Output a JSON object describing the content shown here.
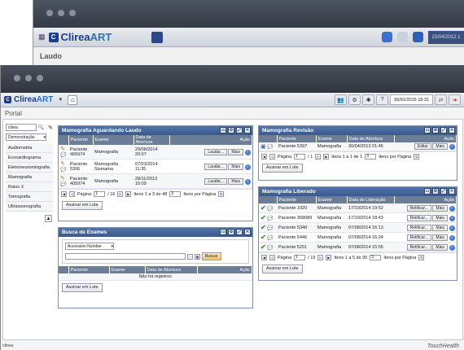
{
  "back_window": {
    "logo": "Clirea",
    "logo_suffix": "ART",
    "date": "23/04/2012 1",
    "page_title": "Laudo"
  },
  "toolbar": {
    "logo": "Clirea",
    "logo_suffix": "ART",
    "datetime": "30/01/2015 18:31"
  },
  "portal_title": "Portal",
  "leftnav": {
    "search_value": "clirea",
    "select_value": "Demonstração",
    "items": [
      "Audiometria",
      "Ecocardiograma",
      "Eletroneuromiografia",
      "Mamografia",
      "Raios X",
      "Tomografia",
      "Ultrassonografia"
    ]
  },
  "panel_aguardando": {
    "title": "Mamografia Aguardando Laudo",
    "headers": [
      "Paciente",
      "Exame",
      "Data de Abertura",
      "Ação"
    ],
    "rows": [
      {
        "paciente": "Paciente 405974",
        "exame": "Mamografia",
        "data": "29/06/2014 20:07"
      },
      {
        "paciente": "Paciente 5306",
        "exame": "Mamografia Sismama",
        "data": "07/03/2014 11:35"
      },
      {
        "paciente": "Paciente 405974",
        "exame": "Mamografia",
        "data": "28/11/2013 10:09"
      }
    ],
    "laudar_label": "Laudar...",
    "mais_label": "Mais",
    "pagina_label": "Página",
    "page": "1",
    "of_pages": "/ 16",
    "items_text": "Itens 1 a 3 de 48",
    "per_page": "3",
    "per_page_label": "Itens por Página",
    "lote_label": "Assinar em Lote"
  },
  "panel_revisao": {
    "title": "Mamografia Revisão",
    "headers": [
      "Paciente",
      "Exame",
      "Data de Abertura",
      "Ação"
    ],
    "rows": [
      {
        "paciente": "Paciente 5397",
        "exame": "Mamografia",
        "data": "30/04/2013 01:45"
      }
    ],
    "editar_label": "Editar",
    "mais_label": "Mais",
    "pagina_label": "Página",
    "page": "1",
    "of_pages": "/ 1",
    "items_text": "Itens 1 a 1 de 1",
    "per_page": "3",
    "per_page_label": "Itens por Página",
    "lote_label": "Assinar em Lote"
  },
  "panel_busca": {
    "title": "Busca de Exames",
    "select_value": "Accession Number",
    "buscar_label": "Buscar",
    "headers": [
      "Paciente",
      "Exame",
      "Data de Abertura",
      "Ação"
    ],
    "empty_text": "Não há registros",
    "lote_label": "Assinar em Lote"
  },
  "panel_liberado": {
    "title": "Mamografia Liberado",
    "headers": [
      "Paciente",
      "Exame",
      "Data de Liberação",
      "Ação"
    ],
    "rows": [
      {
        "paciente": "Paciente 1020",
        "exame": "Mamografia",
        "data": "17/10/2014 19:52"
      },
      {
        "paciente": "Paciente 368089",
        "exame": "Mamografia",
        "data": "17/10/2014 18:43"
      },
      {
        "paciente": "Paciente 5348",
        "exame": "Mamografia",
        "data": "07/08/2014 16:13"
      },
      {
        "paciente": "Paciente 5446",
        "exame": "Mamografia",
        "data": "07/08/2014 16:24"
      },
      {
        "paciente": "Paciente 5201",
        "exame": "Mamografia",
        "data": "07/08/2014 15:55"
      }
    ],
    "retificar_label": "Retificar...",
    "mais_label": "Mais",
    "pagina_label": "Página",
    "page": "1",
    "of_pages": "/ 19",
    "items_text": "Itens 1 a 5 de 95",
    "per_page": "5",
    "per_page_label": "Itens por Página",
    "lote_label": "Assinar em Lote"
  },
  "footer": {
    "left": "clirea",
    "right": "TouchHealth"
  }
}
